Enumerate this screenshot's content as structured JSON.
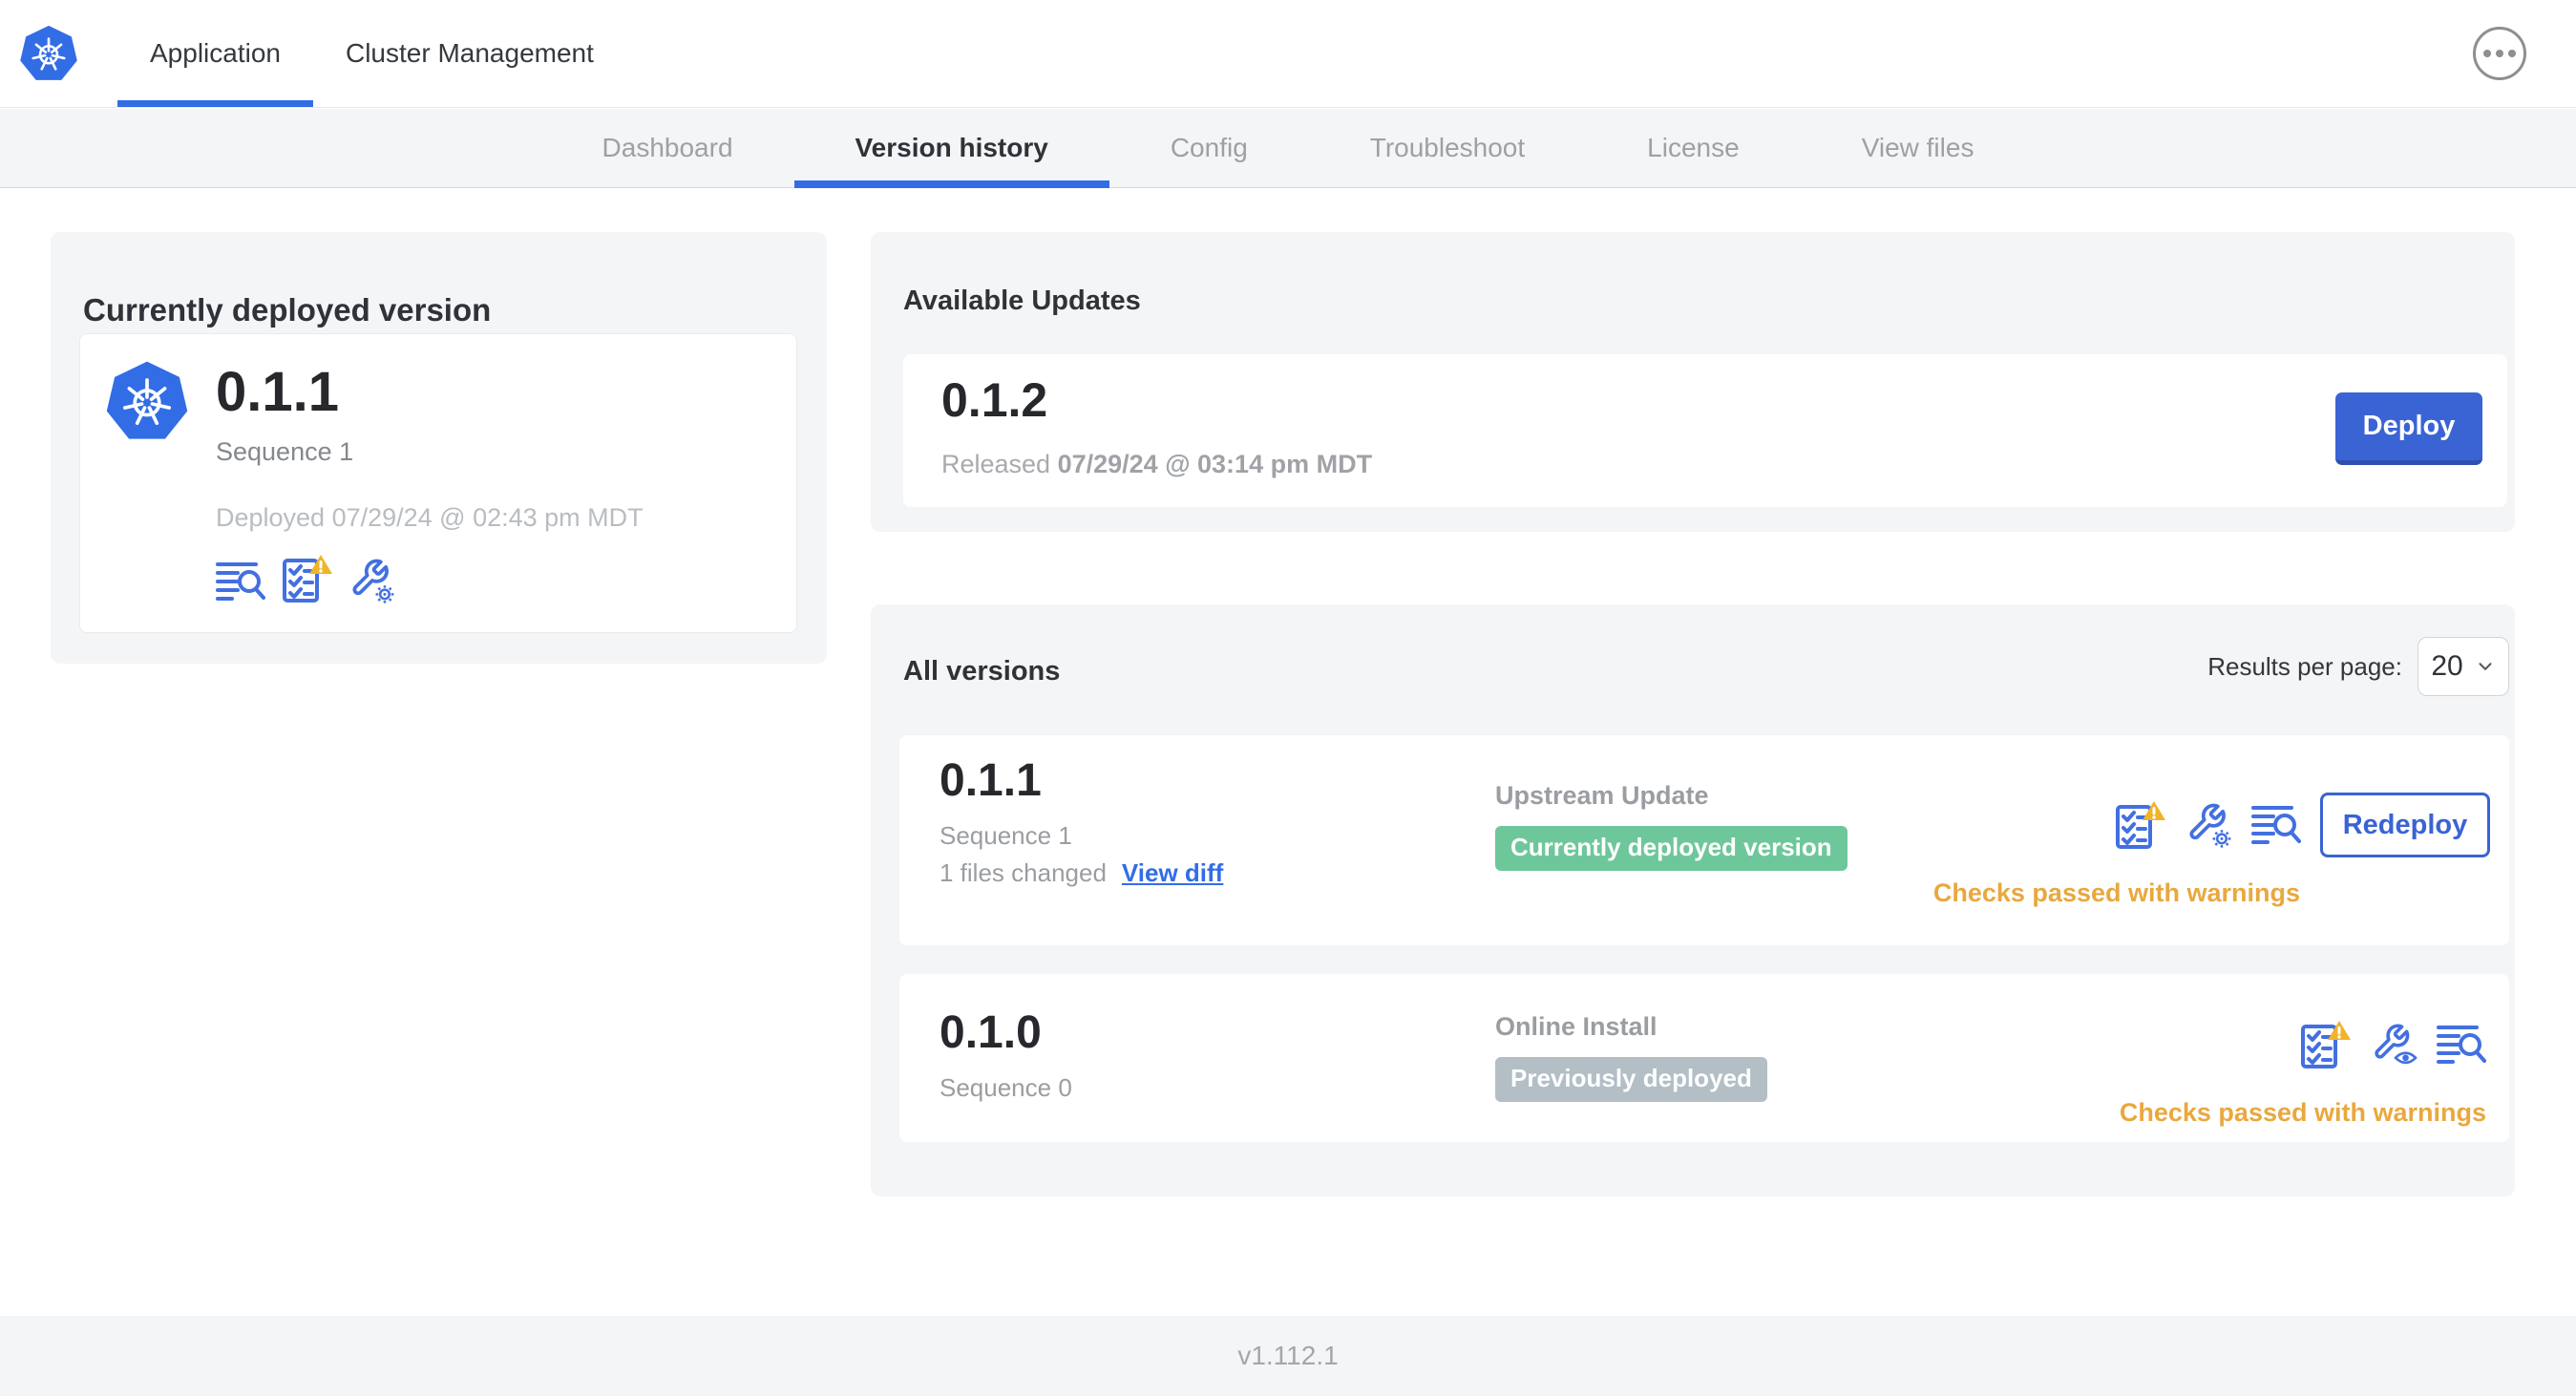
{
  "topnav": {
    "tabs": [
      {
        "label": "Application",
        "active": true
      },
      {
        "label": "Cluster Management",
        "active": false
      }
    ],
    "overflow_menu_icon": "ellipsis-in-circle"
  },
  "subnav": {
    "tabs": [
      {
        "label": "Dashboard",
        "active": false
      },
      {
        "label": "Version history",
        "active": true
      },
      {
        "label": "Config",
        "active": false
      },
      {
        "label": "Troubleshoot",
        "active": false
      },
      {
        "label": "License",
        "active": false
      },
      {
        "label": "View files",
        "active": false
      }
    ]
  },
  "current_version_card": {
    "title": "Currently deployed version",
    "version": "0.1.1",
    "sequence": "Sequence 1",
    "deployed_timestamp": "Deployed 07/29/24 @ 02:43 pm MDT",
    "icons": [
      "diff-lines-magnifier-icon",
      "preflight-checks-warning-icon",
      "config-wrench-gear-icon"
    ]
  },
  "available_updates_card": {
    "title": "Available Updates",
    "update": {
      "version": "0.1.2",
      "released_label": "Released",
      "released_timestamp": "07/29/24 @ 03:14 pm MDT",
      "deploy_button_label": "Deploy"
    }
  },
  "all_versions_card": {
    "title": "All versions",
    "results_per_page_label": "Results per page:",
    "results_per_page_value": "20",
    "rows": [
      {
        "version": "0.1.1",
        "sequence": "Sequence 1",
        "files_changed": "1 files changed",
        "view_diff_label": "View diff",
        "source": "Upstream Update",
        "badge_label": "Currently deployed version",
        "badge_type": "success",
        "icons": [
          "preflight-checks-warning-icon",
          "config-wrench-gear-icon",
          "diff-lines-magnifier-icon"
        ],
        "action_button_label": "Redeploy",
        "status_text": "Checks passed with warnings"
      },
      {
        "version": "0.1.0",
        "sequence": "Sequence 0",
        "source": "Online Install",
        "badge_label": "Previously deployed",
        "badge_type": "neutral",
        "icons": [
          "preflight-checks-warning-icon",
          "config-wrench-eye-icon",
          "diff-lines-magnifier-icon"
        ],
        "status_text": "Checks passed with warnings"
      }
    ]
  },
  "footer": {
    "version": "v1.112.1"
  },
  "colors": {
    "primary_blue": "#326de6",
    "button_blue": "#3a63d4",
    "icon_blue": "#4370e0",
    "warning_amber_text": "#e9a83e",
    "warning_triangle": "#f0b429",
    "success_badge_green": "#6ec79b",
    "neutral_badge_gray": "#b3bec5",
    "card_background": "#f4f5f7",
    "dark_text": "#2d3136",
    "muted_text": "#9a9da1"
  }
}
